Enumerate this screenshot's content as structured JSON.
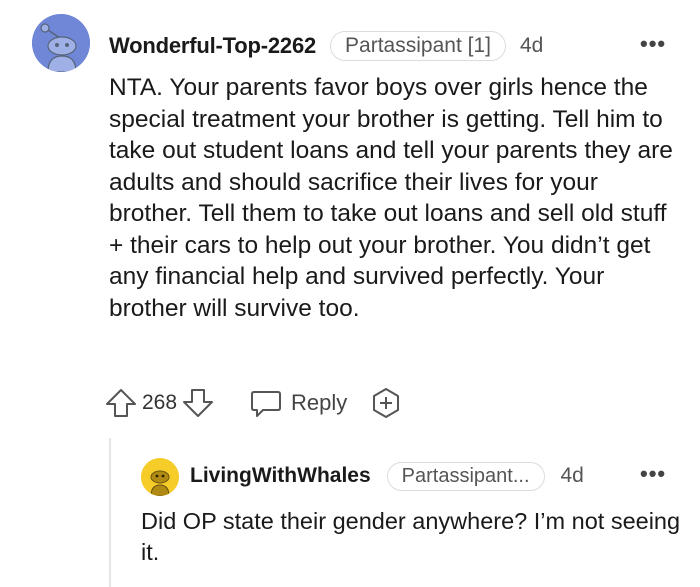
{
  "comment": {
    "username": "Wonderful-Top-2262",
    "flair": "Partassipant [1]",
    "age": "4d",
    "more": "•••",
    "body": "NTA. Your parents favor boys over girls hence the special treatment your brother is getting. Tell him to take out student loans and tell your parents they are adults and should sacrifice their lives for your brother. Tell them to take out loans and sell old stuff + their cars to help out your brother. You didn’t get any financial help and survived perfectly. Your brother will survive too.",
    "score": "268",
    "reply_label": "Reply",
    "icons": {
      "upvote": "upvote-arrow-icon",
      "downvote": "downvote-arrow-icon",
      "reply": "speech-bubble-icon",
      "award": "award-plus-icon"
    },
    "avatar_color": "#6f87d6"
  },
  "reply": {
    "username": "LivingWithWhales",
    "flair": "Partassipant...",
    "age": "4d",
    "more": "•••",
    "body": "Did OP state their gender anywhere? I’m not seeing it.",
    "avatar_color": "#f5cc28"
  }
}
